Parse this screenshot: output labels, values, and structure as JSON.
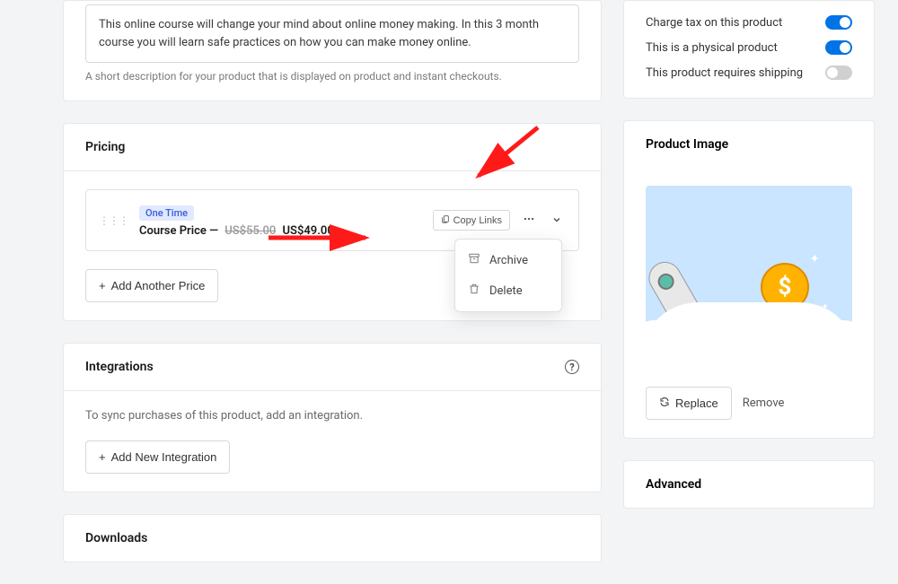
{
  "description": {
    "text": "This online course will change your mind about online money making. In this 3 month course you will learn safe practices on how you can make money online.",
    "help": "A short description for your product that is displayed on product and instant checkouts."
  },
  "pricing": {
    "title": "Pricing",
    "tag": "One Time",
    "name": "Course Price",
    "old_price": "US$55.00",
    "price": "US$49.00",
    "copy_links": "Copy Links",
    "add_btn": "Add Another Price",
    "menu": {
      "archive": "Archive",
      "delete": "Delete"
    }
  },
  "integrations": {
    "title": "Integrations",
    "desc": "To sync purchases of this product, add an integration.",
    "add_btn": "Add New Integration"
  },
  "downloads": {
    "title": "Downloads"
  },
  "shipping": {
    "tax": "Charge tax on this product",
    "physical": "This is a physical product",
    "requires": "This product requires shipping"
  },
  "product_image": {
    "title": "Product Image",
    "replace": "Replace",
    "remove": "Remove"
  },
  "advanced": {
    "title": "Advanced"
  }
}
